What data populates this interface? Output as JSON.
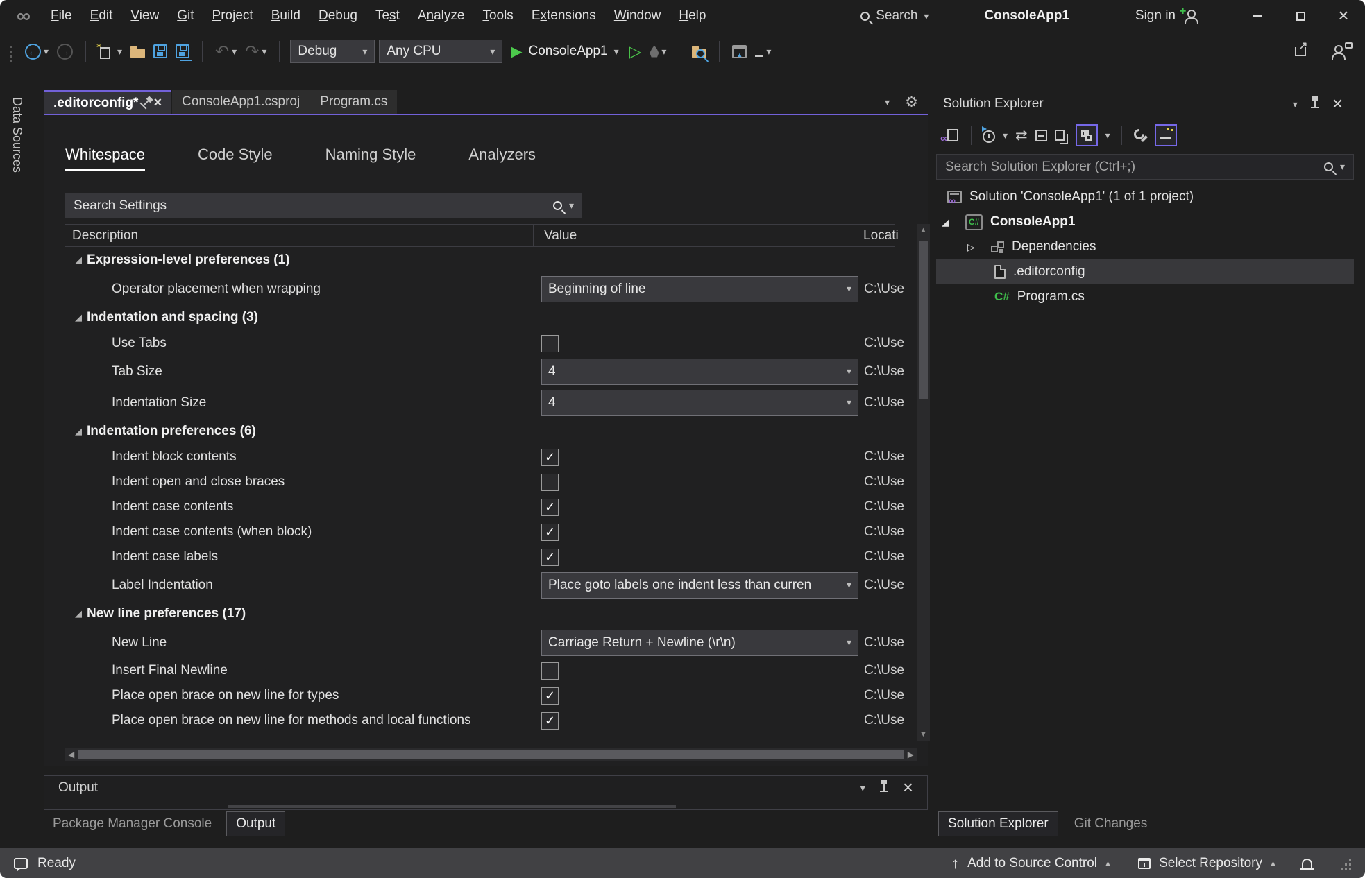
{
  "colors": {
    "accent_purple": "#7261D9",
    "box_purple": "#7668E8",
    "green": "#3FBF4C",
    "blue": "#4FA3E0",
    "folder_yellow": "#DCB67A",
    "statusbar": "#414144",
    "selection": "#38383b"
  },
  "titlebar": {
    "menus": [
      {
        "label": "File",
        "u": 0
      },
      {
        "label": "Edit",
        "u": 0
      },
      {
        "label": "View",
        "u": 0
      },
      {
        "label": "Git",
        "u": 0
      },
      {
        "label": "Project",
        "u": 0
      },
      {
        "label": "Build",
        "u": 0
      },
      {
        "label": "Debug",
        "u": 0
      },
      {
        "label": "Test",
        "u": 2
      },
      {
        "label": "Analyze",
        "u": 1
      },
      {
        "label": "Tools",
        "u": 0
      },
      {
        "label": "Extensions",
        "u": 1
      },
      {
        "label": "Window",
        "u": 0
      },
      {
        "label": "Help",
        "u": 0
      }
    ],
    "search_label": "Search",
    "app_title": "ConsoleApp1",
    "sign_in_label": "Sign in"
  },
  "toolbar": {
    "configuration": "Debug",
    "platform": "Any CPU",
    "startup_project": "ConsoleApp1"
  },
  "left_strip": {
    "label": "Data Sources"
  },
  "editor": {
    "tabs": [
      {
        "label": ".editorconfig*",
        "active": true
      },
      {
        "label": "ConsoleApp1.csproj",
        "active": false
      },
      {
        "label": "Program.cs",
        "active": false
      }
    ],
    "inner_tabs": [
      {
        "label": "Whitespace",
        "active": true
      },
      {
        "label": "Code Style",
        "active": false
      },
      {
        "label": "Naming Style",
        "active": false
      },
      {
        "label": "Analyzers",
        "active": false
      }
    ],
    "search_placeholder": "Search Settings",
    "columns": [
      "Description",
      "Value",
      "Locati"
    ],
    "location_value": "C:\\Use",
    "rows": [
      {
        "type": "group",
        "label": "Expression-level preferences  (1)"
      },
      {
        "type": "dropdown",
        "label": "Operator placement when wrapping",
        "value": "Beginning of line"
      },
      {
        "type": "group",
        "label": "Indentation and spacing  (3)"
      },
      {
        "type": "checkbox",
        "label": "Use Tabs",
        "checked": false
      },
      {
        "type": "dropdown",
        "label": "Tab Size",
        "value": "4"
      },
      {
        "type": "dropdown",
        "label": "Indentation Size",
        "value": "4"
      },
      {
        "type": "group",
        "label": "Indentation preferences  (6)"
      },
      {
        "type": "checkbox",
        "label": "Indent block contents",
        "checked": true
      },
      {
        "type": "checkbox",
        "label": "Indent open and close braces",
        "checked": false
      },
      {
        "type": "checkbox",
        "label": "Indent case contents",
        "checked": true
      },
      {
        "type": "checkbox",
        "label": "Indent case contents (when block)",
        "checked": true
      },
      {
        "type": "checkbox",
        "label": "Indent case labels",
        "checked": true
      },
      {
        "type": "dropdown",
        "label": "Label Indentation",
        "value": "Place goto labels one indent less than curren"
      },
      {
        "type": "group",
        "label": "New line preferences  (17)"
      },
      {
        "type": "dropdown",
        "label": "New Line",
        "value": "Carriage Return + Newline (\\r\\n)"
      },
      {
        "type": "checkbox",
        "label": "Insert Final Newline",
        "checked": false
      },
      {
        "type": "checkbox",
        "label": "Place open brace on new line for types",
        "checked": true
      },
      {
        "type": "checkbox",
        "label": "Place open brace on new line for methods and local functions",
        "checked": true
      }
    ]
  },
  "output_panel": {
    "title": "Output",
    "tabs": [
      "Package Manager Console",
      "Output"
    ],
    "active_tab": 1
  },
  "solution_explorer": {
    "title": "Solution Explorer",
    "search_placeholder": "Search Solution Explorer (Ctrl+;)",
    "tree": [
      {
        "label": "Solution 'ConsoleApp1' (1 of 1 project)",
        "icon": "solution",
        "expander": "none",
        "pad": 16,
        "bold": false,
        "selected": false
      },
      {
        "label": "ConsoleApp1",
        "icon": "csproject",
        "expander": "open",
        "pad": 8,
        "bold": true,
        "selected": false
      },
      {
        "label": "Dependencies",
        "icon": "dependencies",
        "expander": "closed",
        "pad": 45,
        "bold": false,
        "selected": false
      },
      {
        "label": ".editorconfig",
        "icon": "file",
        "expander": "none",
        "pad": 84,
        "bold": false,
        "selected": true
      },
      {
        "label": "Program.cs",
        "icon": "csfile",
        "expander": "none",
        "pad": 84,
        "bold": false,
        "selected": false
      }
    ],
    "tabs": [
      "Solution Explorer",
      "Git Changes"
    ],
    "active_tab": 0
  },
  "status_bar": {
    "ready": "Ready",
    "add_to_source_control": "Add to Source Control",
    "select_repository": "Select Repository"
  }
}
